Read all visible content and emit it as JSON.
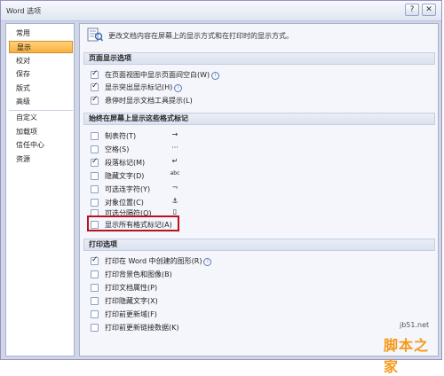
{
  "window": {
    "title": "Word 选项",
    "help_glyph": "?",
    "close_glyph": "✕"
  },
  "nav": {
    "items": [
      {
        "label": "常用"
      },
      {
        "label": "显示",
        "active": true
      },
      {
        "label": "校对"
      },
      {
        "label": "保存"
      },
      {
        "label": "版式"
      },
      {
        "label": "高级"
      },
      {
        "label": "自定义"
      },
      {
        "label": "加载项"
      },
      {
        "label": "信任中心"
      },
      {
        "label": "资源"
      }
    ]
  },
  "header": {
    "text": "更改文档内容在屏幕上的显示方式和在打印时的显示方式。",
    "icon": "page-display-icon"
  },
  "sections": {
    "page_display": {
      "title": "页面显示选项",
      "options": [
        {
          "label": "在页面视图中显示页面间空白(W)",
          "checked": true,
          "info": true
        },
        {
          "label": "显示突出显示标记(H)",
          "checked": true,
          "info": true
        },
        {
          "label": "悬停时显示文档工具提示(L)",
          "checked": true
        }
      ]
    },
    "format_marks": {
      "title": "始终在屏幕上显示这些格式标记",
      "options": [
        {
          "label": "制表符(T)",
          "checked": false,
          "mark": "→"
        },
        {
          "label": "空格(S)",
          "checked": false,
          "mark": "···"
        },
        {
          "label": "段落标记(M)",
          "checked": true,
          "mark": "↵"
        },
        {
          "label": "隐藏文字(D)",
          "checked": false,
          "mark": "abc"
        },
        {
          "label": "可选连字符(Y)",
          "checked": false,
          "mark": "¬"
        },
        {
          "label": "对象位置(C)",
          "checked": false,
          "mark": "⚓"
        },
        {
          "label": "可选分隔符(O)",
          "checked": false,
          "mark": "▯"
        },
        {
          "label": "显示所有格式标记(A)",
          "checked": false
        }
      ]
    },
    "print": {
      "title": "打印选项",
      "options": [
        {
          "label": "打印在 Word 中创建的图形(R)",
          "checked": true,
          "info": true
        },
        {
          "label": "打印背景色和图像(B)",
          "checked": false
        },
        {
          "label": "打印文档属性(P)",
          "checked": false
        },
        {
          "label": "打印隐藏文字(X)",
          "checked": false
        },
        {
          "label": "打印前更新域(F)",
          "checked": false
        },
        {
          "label": "打印前更新链接数据(K)",
          "checked": false
        }
      ]
    }
  },
  "watermark": {
    "url": "jb51.net",
    "logo": "脚本之家"
  },
  "colors": {
    "active_nav": "#f7b040",
    "highlight_box": "#b5141e",
    "section_bg": "#dbe2ef"
  }
}
